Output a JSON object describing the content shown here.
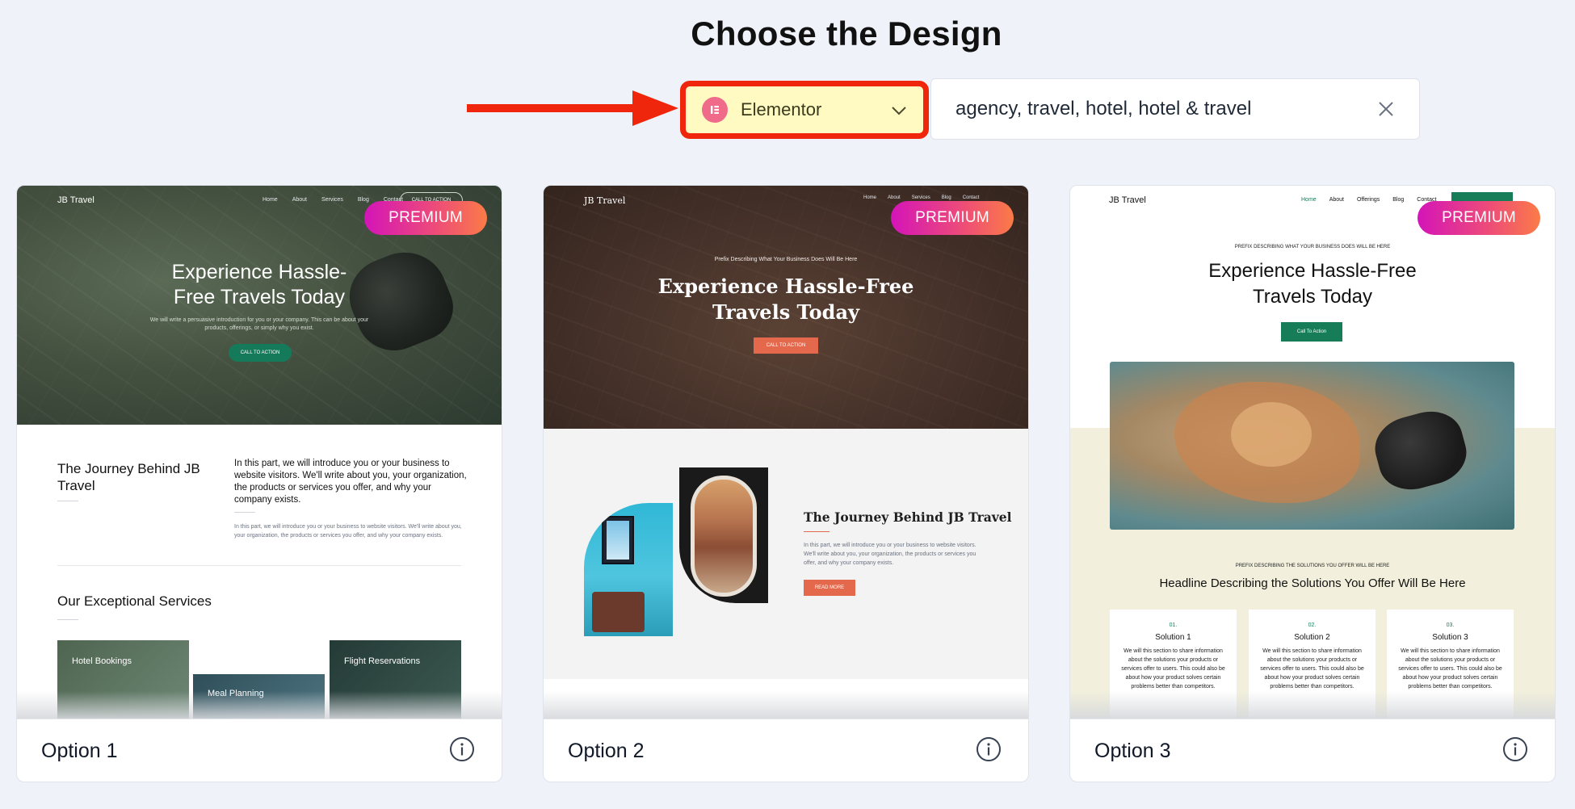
{
  "page": {
    "title": "Choose the Design"
  },
  "builder": {
    "selected": "Elementor",
    "logo_icon": "elementor-logo-icon",
    "accent": "#f0260c",
    "bg": "#fff9c2"
  },
  "search": {
    "value": "agency, travel, hotel, hotel & travel"
  },
  "badge": {
    "label": "PREMIUM"
  },
  "options": [
    {
      "label": "Option 1",
      "preview": {
        "brand": "JB Travel",
        "nav": [
          "Home",
          "About",
          "Services",
          "Blog",
          "Contact"
        ],
        "nav_button": "CALL TO ACTION",
        "hero_title": "Experience Hassle-Free Travels Today",
        "hero_sub": "We will write a persuasive introduction for you or your company. This can be about your products, offerings, or simply why you exist.",
        "cta": "CALL TO ACTION",
        "about_title": "The Journey Behind JB Travel",
        "about_text": "In this part, we will introduce you or your business to website visitors. We'll write about you, your organization, the products or services you offer, and why your company exists.",
        "about_small": "In this part, we will introduce you or your business to website visitors. We'll write about you, your organization, the products or services you offer, and why your company exists.",
        "services_title": "Our Exceptional Services",
        "services": [
          "Hotel Bookings",
          "Meal Planning",
          "Flight Reservations"
        ]
      }
    },
    {
      "label": "Option 2",
      "preview": {
        "brand": "JB Travel",
        "nav": [
          "Home",
          "About",
          "Services",
          "Blog",
          "Contact"
        ],
        "pre": "Prefix Describing What Your Business Does Will Be Here",
        "hero_title": "Experience Hassle-Free Travels Today",
        "cta": "CALL TO ACTION",
        "about_title": "The Journey Behind JB Travel",
        "about_text": "In this part, we will introduce you or your business to website visitors. We'll write about you, your organization, the products or services you offer, and why your company exists.",
        "button": "READ MORE"
      }
    },
    {
      "label": "Option 3",
      "preview": {
        "brand": "JB Travel",
        "nav": [
          "Home",
          "About",
          "Offerings",
          "Blog",
          "Contact"
        ],
        "pre": "PREFIX DESCRIBING WHAT YOUR BUSINESS DOES WILL BE HERE",
        "hero_title": "Experience Hassle-Free Travels Today",
        "cta": "Call To Action",
        "pre2": "PREFIX DESCRIBING THE SOLUTIONS YOU OFFER WILL BE HERE",
        "headline": "Headline Describing the Solutions You Offer Will Be Here",
        "solutions": [
          {
            "num": "01.",
            "title": "Solution 1",
            "text": "We will this section to share information about the solutions your products or services offer to users. This could also be about how your product solves certain problems better than competitors."
          },
          {
            "num": "02.",
            "title": "Solution 2",
            "text": "We will this section to share information about the solutions your products or services offer to users. This could also be about how your product solves certain problems better than competitors."
          },
          {
            "num": "03.",
            "title": "Solution 3",
            "text": "We will this section to share information about the solutions your products or services offer to users. This could also be about how your product solves certain problems better than competitors."
          }
        ]
      }
    }
  ]
}
